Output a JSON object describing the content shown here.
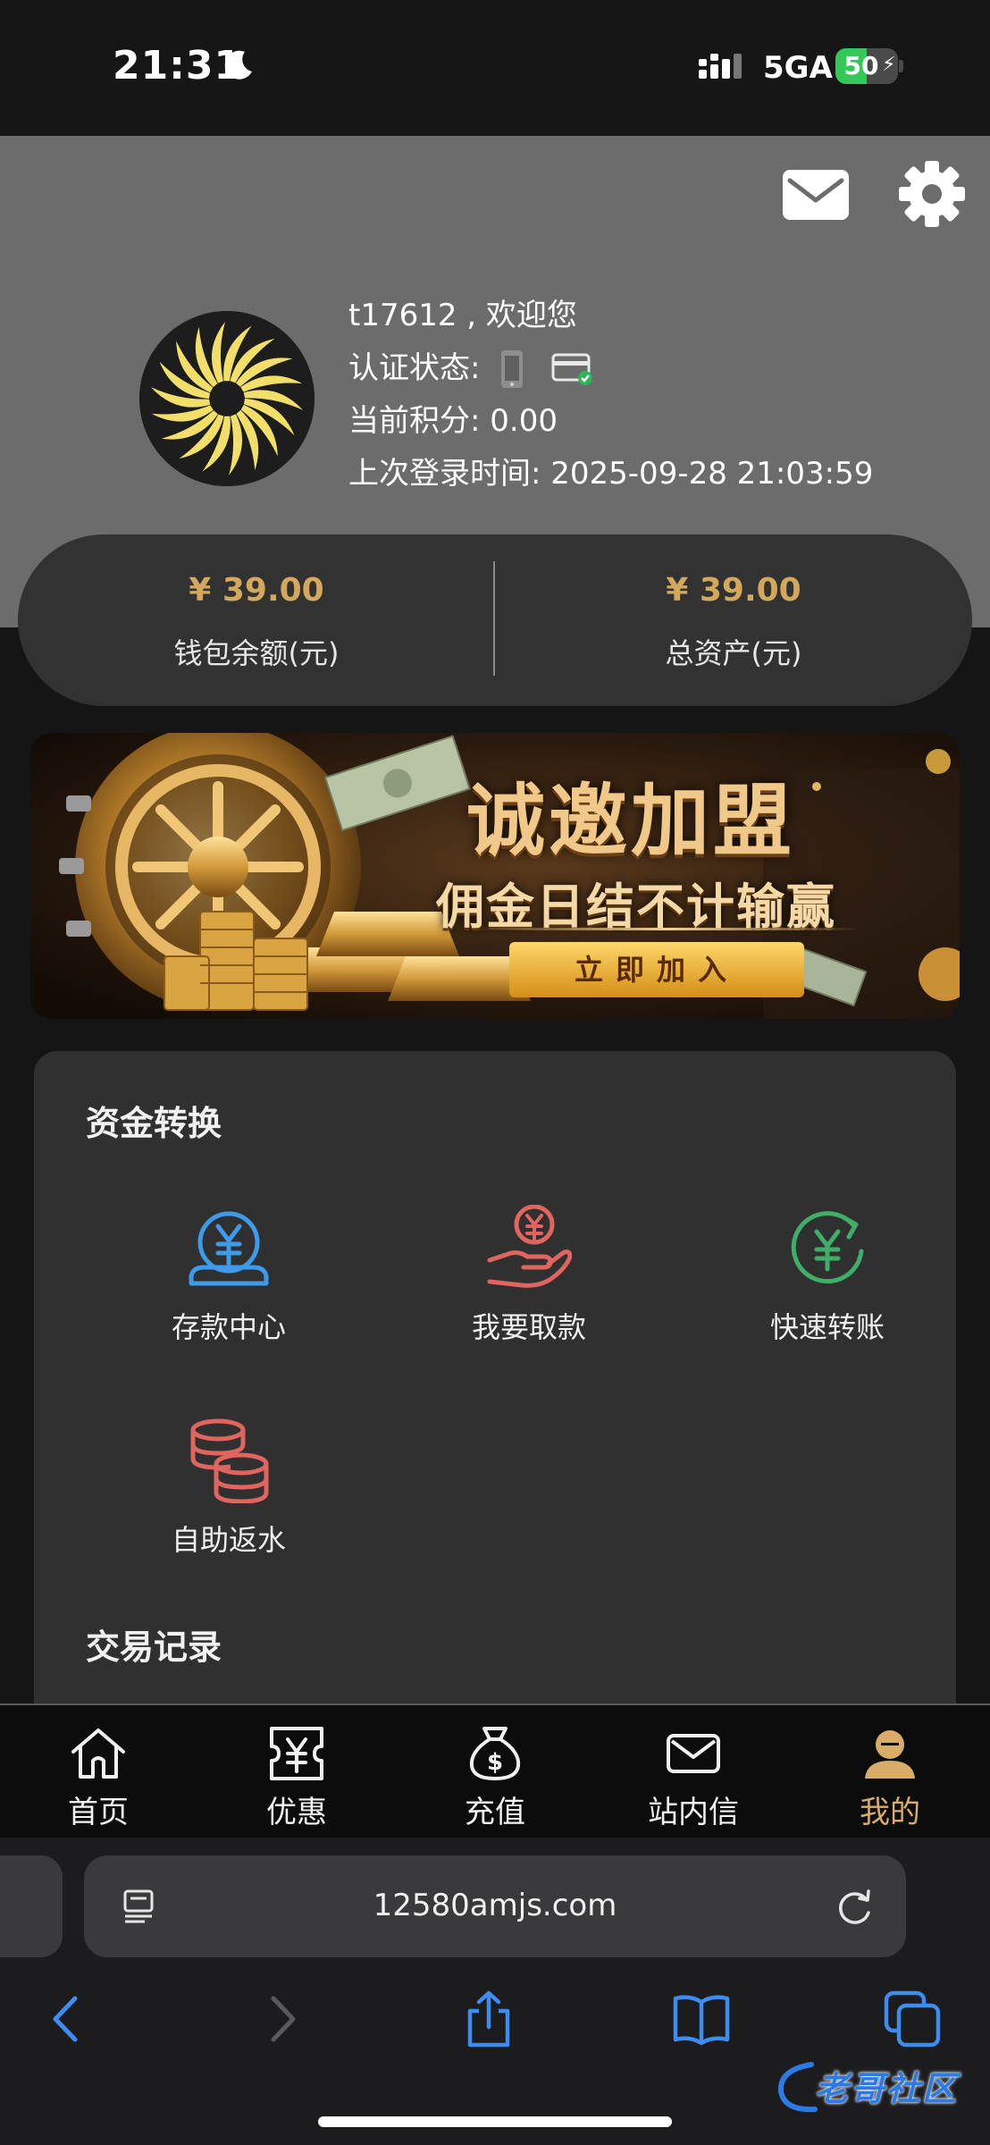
{
  "status_bar": {
    "time": "21:31",
    "network": "5GA",
    "battery": "50",
    "battery_level": 0.5
  },
  "header": {
    "mail_icon": "mail-icon",
    "settings_icon": "gear-icon",
    "greeting": "t17612 , 欢迎您",
    "verify_label": "认证状态:",
    "points_label": "当前积分: 0.00",
    "last_login_label": "上次登录时间: 2025-09-28 21:03:59"
  },
  "balance": {
    "wallet_amount": "¥ 39.00",
    "wallet_label": "钱包余额(元)",
    "total_amount": "¥ 39.00",
    "total_label": "总资产(元)"
  },
  "banner": {
    "title": "诚邀加盟",
    "subtitle": "佣金日结不计输赢",
    "cta": "立即加入"
  },
  "funds": {
    "title": "资金转换",
    "items": [
      {
        "label": "存款中心",
        "icon": "deposit-icon",
        "color": "#3d9be9"
      },
      {
        "label": "我要取款",
        "icon": "withdraw-icon",
        "color": "#e0655f"
      },
      {
        "label": "快速转账",
        "icon": "transfer-icon",
        "color": "#3fae67"
      },
      {
        "label": "自助返水",
        "icon": "coins-icon",
        "color": "#e0655f"
      }
    ],
    "records_title": "交易记录"
  },
  "nav": {
    "items": [
      {
        "label": "首页",
        "icon": "home-icon"
      },
      {
        "label": "优惠",
        "icon": "ticket-icon"
      },
      {
        "label": "充值",
        "icon": "money-bag-icon"
      },
      {
        "label": "站内信",
        "icon": "mail-icon"
      },
      {
        "label": "我的",
        "icon": "user-icon"
      }
    ],
    "active": "我的",
    "active_color": "#d9ac6a"
  },
  "browser": {
    "url": "12580amjs.com"
  },
  "watermark": "老哥社区"
}
